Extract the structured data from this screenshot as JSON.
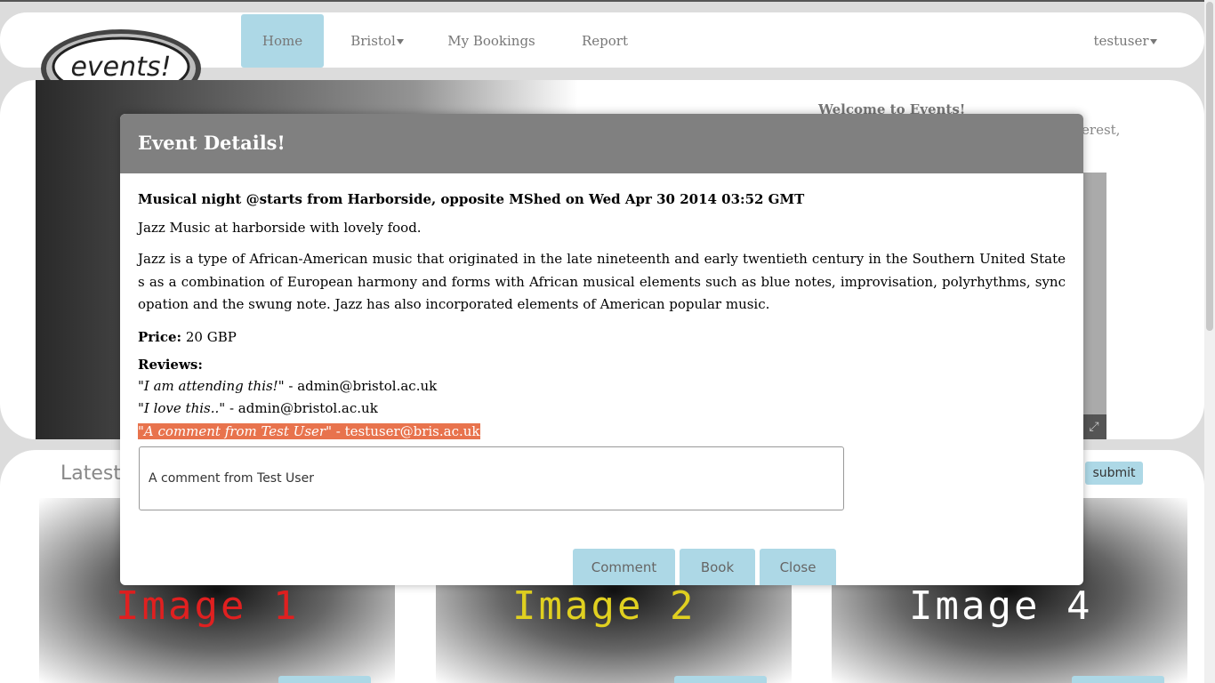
{
  "nav": {
    "items": [
      {
        "label": "Home"
      },
      {
        "label": "Bristol"
      },
      {
        "label": "My Bookings"
      },
      {
        "label": "Report"
      }
    ],
    "user": "testuser"
  },
  "logo_text": "events!",
  "hero": {
    "welcome": "Welcome to Events!",
    "welcome_sub": "terest,"
  },
  "latest_label": "Latest",
  "submit_label": "submit",
  "tiles": [
    {
      "label": "Image 1",
      "color": "#e02020"
    },
    {
      "label": "Image 2",
      "color": "#e0d020"
    },
    {
      "label": "Image 4",
      "color": "#ffffff"
    }
  ],
  "modal": {
    "title": "Event Details!",
    "event_title": "Musical night @starts from Harborside, opposite MShed on Wed Apr 30 2014 03:52 GMT",
    "short_desc": "Jazz Music at harborside with lovely food.",
    "long_desc": "Jazz is a type of African-American music that originated in the late nineteenth and early twentieth century in the Southern United States as a combination of European harmony and forms with African musical elements such as blue notes, improvisation, polyrhythms, syncopation and the swung note. Jazz has also incorporated elements of American popular music.",
    "price_label": "Price:",
    "price_value": "20 GBP",
    "reviews_label": "Reviews:",
    "reviews": [
      {
        "text": "I am attending this!",
        "author": "admin@bristol.ac.uk"
      },
      {
        "text": "I love this..",
        "author": "admin@bristol.ac.uk"
      },
      {
        "text": "A comment from Test User",
        "author": "testuser@bris.ac.uk"
      }
    ],
    "comment_value": "A comment from Test User",
    "buttons": {
      "comment": "Comment",
      "book": "Book",
      "close": "Close"
    }
  },
  "colors": {
    "accent": "#add8e6",
    "modal_header": "#808080",
    "highlight": "#e8734d"
  }
}
